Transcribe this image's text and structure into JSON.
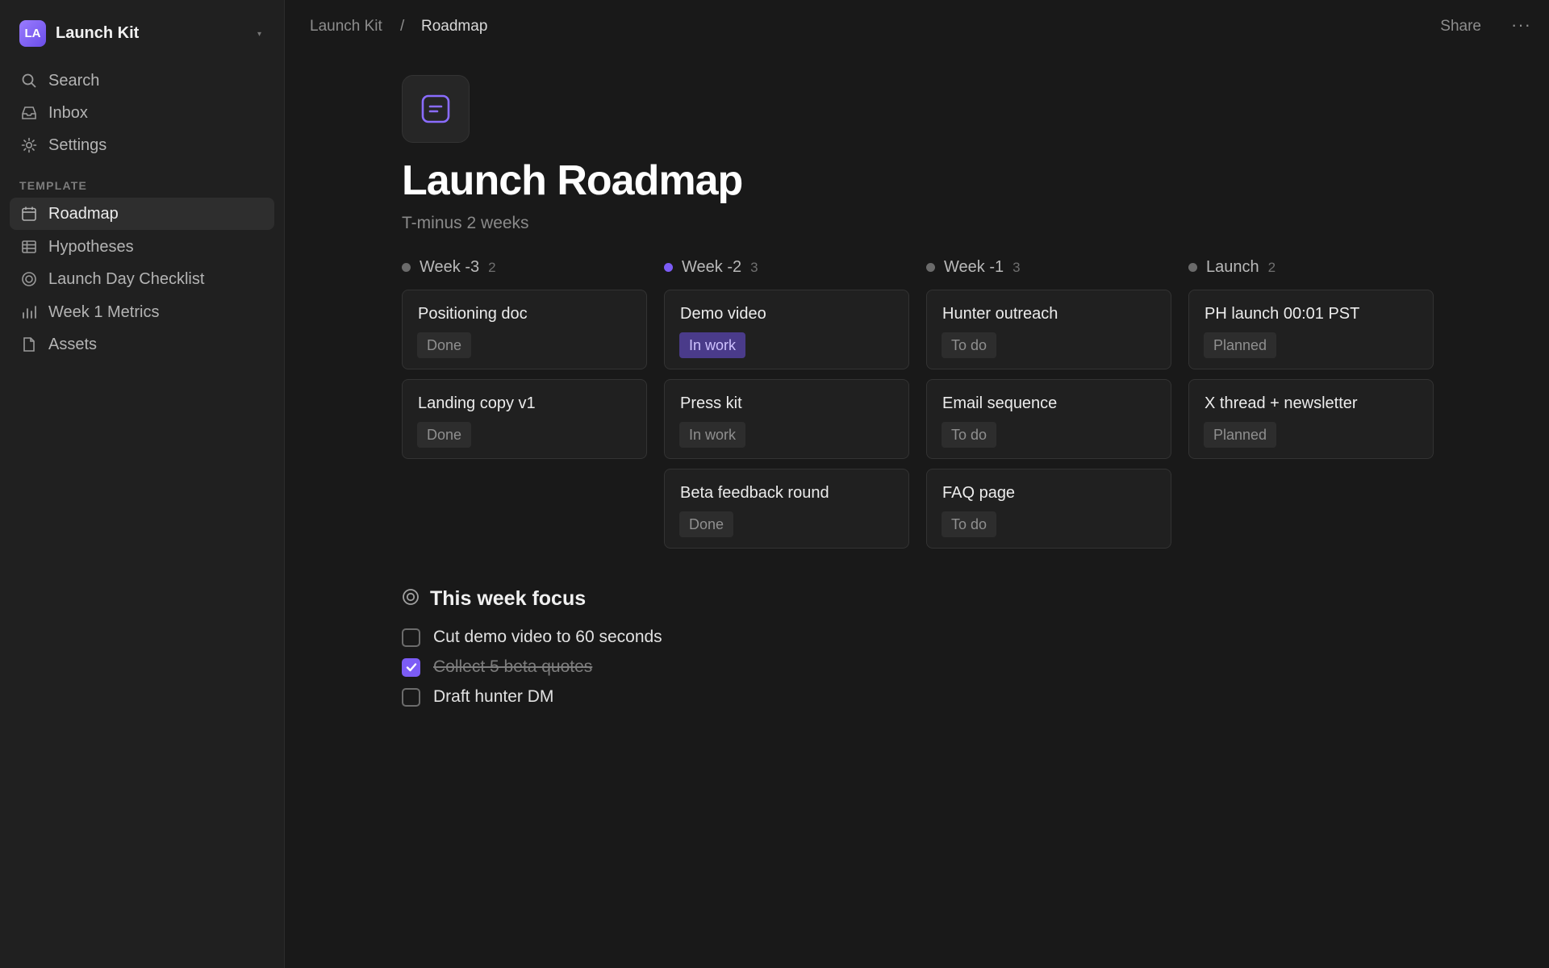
{
  "sidebar": {
    "workspace": {
      "avatar": "LA",
      "name": "Launch Kit",
      "chevron": "▾"
    },
    "nav": [
      {
        "label": "Search",
        "icon": "search-icon"
      },
      {
        "label": "Inbox",
        "icon": "inbox-icon"
      },
      {
        "label": "Settings",
        "icon": "gear-icon"
      }
    ],
    "section_label": "TEMPLATE",
    "pages": [
      {
        "label": "Roadmap",
        "icon": "calendar-icon",
        "active": true
      },
      {
        "label": "Hypotheses",
        "icon": "table-icon"
      },
      {
        "label": "Launch Day Checklist",
        "icon": "target-icon"
      },
      {
        "label": "Week 1 Metrics",
        "icon": "bar-chart-icon"
      },
      {
        "label": "Assets",
        "icon": "file-icon"
      }
    ]
  },
  "topbar": {
    "breadcrumb": [
      "Launch Kit",
      "Roadmap"
    ],
    "separator": "/",
    "share": "Share",
    "more": "···"
  },
  "page": {
    "icon": "document-icon",
    "title": "Launch Roadmap",
    "subtitle": "T-minus 2 weeks"
  },
  "board": {
    "columns": [
      {
        "name": "Week -3",
        "count": "2",
        "dot": "#6b6b6b",
        "cards": [
          {
            "title": "Positioning doc",
            "status": "Done"
          },
          {
            "title": "Landing copy v1",
            "status": "Done"
          }
        ]
      },
      {
        "name": "Week -2",
        "count": "3",
        "dot": "#7c5cf6",
        "cards": [
          {
            "title": "Demo video",
            "status": "In work",
            "highlight": true
          },
          {
            "title": "Press kit",
            "status": "In work"
          },
          {
            "title": "Beta feedback round",
            "status": "Done"
          }
        ]
      },
      {
        "name": "Week -1",
        "count": "3",
        "dot": "#6b6b6b",
        "cards": [
          {
            "title": "Hunter outreach",
            "status": "To do"
          },
          {
            "title": "Email sequence",
            "status": "To do"
          },
          {
            "title": "FAQ page",
            "status": "To do"
          }
        ]
      },
      {
        "name": "Launch",
        "count": "2",
        "dot": "#6b6b6b",
        "cards": [
          {
            "title": "PH launch 00:01 PST",
            "status": "Planned"
          },
          {
            "title": "X thread + newsletter",
            "status": "Planned"
          }
        ]
      }
    ]
  },
  "focus": {
    "icon": "target-icon",
    "title": "This week focus",
    "items": [
      {
        "text": "Cut demo video to 60 seconds",
        "checked": false
      },
      {
        "text": "Collect 5 beta quotes",
        "checked": true
      },
      {
        "text": "Draft hunter DM",
        "checked": false
      }
    ]
  },
  "colors": {
    "accent": "#7c5cf6",
    "background": "#191919",
    "sidebar": "#202020"
  }
}
